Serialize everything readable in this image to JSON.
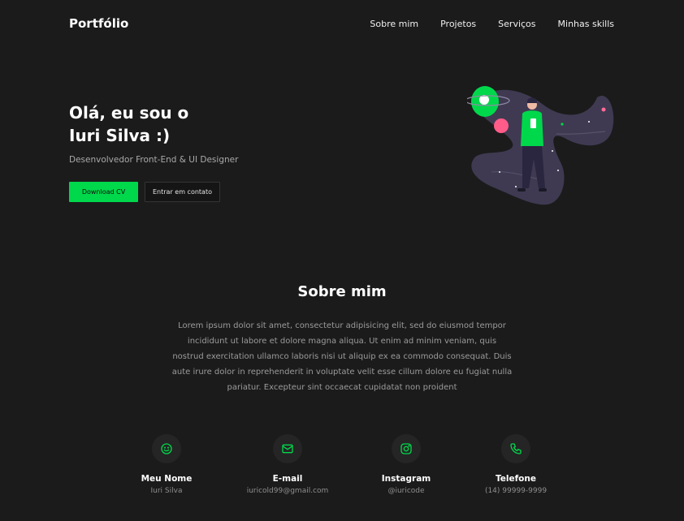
{
  "header": {
    "logo": "Portfólio",
    "nav": [
      "Sobre mim",
      "Projetos",
      "Serviços",
      "Minhas skills"
    ]
  },
  "hero": {
    "title_line1": "Olá, eu sou o",
    "title_line2": "Iuri Silva :)",
    "subtitle": "Desenvolvedor Front-End & UI Designer",
    "primary_button": "Download CV",
    "secondary_button": "Entrar em contato",
    "illustration_icon": "astronaut-space-illustration"
  },
  "about": {
    "title": "Sobre mim",
    "text": "Lorem ipsum dolor sit amet, consectetur adipisicing elit, sed do eiusmod tempor incididunt ut labore et dolore magna aliqua. Ut enim ad minim veniam, quis nostrud exercitation ullamco laboris nisi ut aliquip ex ea commodo consequat. Duis aute irure dolor in reprehenderit in voluptate velit esse cillum dolore eu fugiat nulla pariatur. Excepteur sint occaecat cupidatat non proident"
  },
  "contacts": [
    {
      "icon": "smile-icon",
      "label": "Meu Nome",
      "value": "Iuri Silva"
    },
    {
      "icon": "mail-icon",
      "label": "E-mail",
      "value": "iuricold99@gmail.com"
    },
    {
      "icon": "instagram-icon",
      "label": "Instagram",
      "value": "@iuricode"
    },
    {
      "icon": "phone-icon",
      "label": "Telefone",
      "value": "(14) 99999-9999"
    }
  ],
  "colors": {
    "background": "#1b1b1b",
    "accent": "#00d84c",
    "icon_circle": "#252525",
    "muted_text": "#9b9b9b"
  }
}
